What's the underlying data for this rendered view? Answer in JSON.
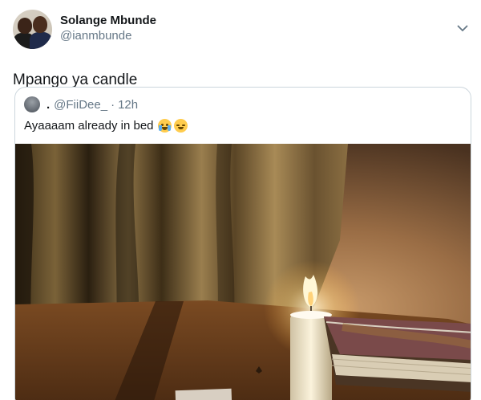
{
  "tweet": {
    "display_name": "Solange Mbunde",
    "handle": "@ianmbunde",
    "text": "Mpango ya candle",
    "avatar_icon": "profile-avatar",
    "menu_icon": "chevron-down-icon"
  },
  "quoted": {
    "display_name": ".",
    "handle": "@FiiDee_",
    "separator": "·",
    "time": "12h",
    "text": "Ayaaaam already in bed",
    "emojis": [
      "loudly-crying-face",
      "relieved-face"
    ],
    "media_icon": "photo-candle-bedside"
  },
  "colors": {
    "text_primary": "#14171a",
    "text_secondary": "#657786",
    "border": "#ccd6dd",
    "accent": "#1da1f2"
  }
}
